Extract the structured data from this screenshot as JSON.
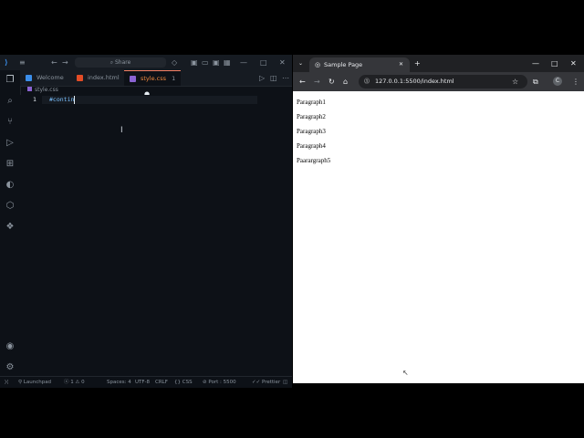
{
  "vscode": {
    "command_center": "Share",
    "tabs": [
      {
        "label": "Welcome"
      },
      {
        "label": "index.html"
      },
      {
        "label": "style.css",
        "badge": "1"
      }
    ],
    "breadcrumb": "style.css",
    "editor": {
      "line_number": "1",
      "code": "#contin"
    },
    "status": {
      "launchpad": "Launchpad",
      "problems": "ⓧ 1 ⚠ 0",
      "spaces": "Spaces: 4",
      "encoding": "UTF-8",
      "eol": "CRLF",
      "language": "CSS",
      "port": "Port : 5500",
      "prettier": "Prettier"
    }
  },
  "chrome": {
    "tab_title": "Sample Page",
    "url": "127.0.0.1:5500/index.html",
    "profile_initial": "C",
    "paragraphs": [
      "Paragraph1",
      "Paragraph2",
      "Paragraph3",
      "Paragraph4",
      "Paarargraph5"
    ]
  }
}
